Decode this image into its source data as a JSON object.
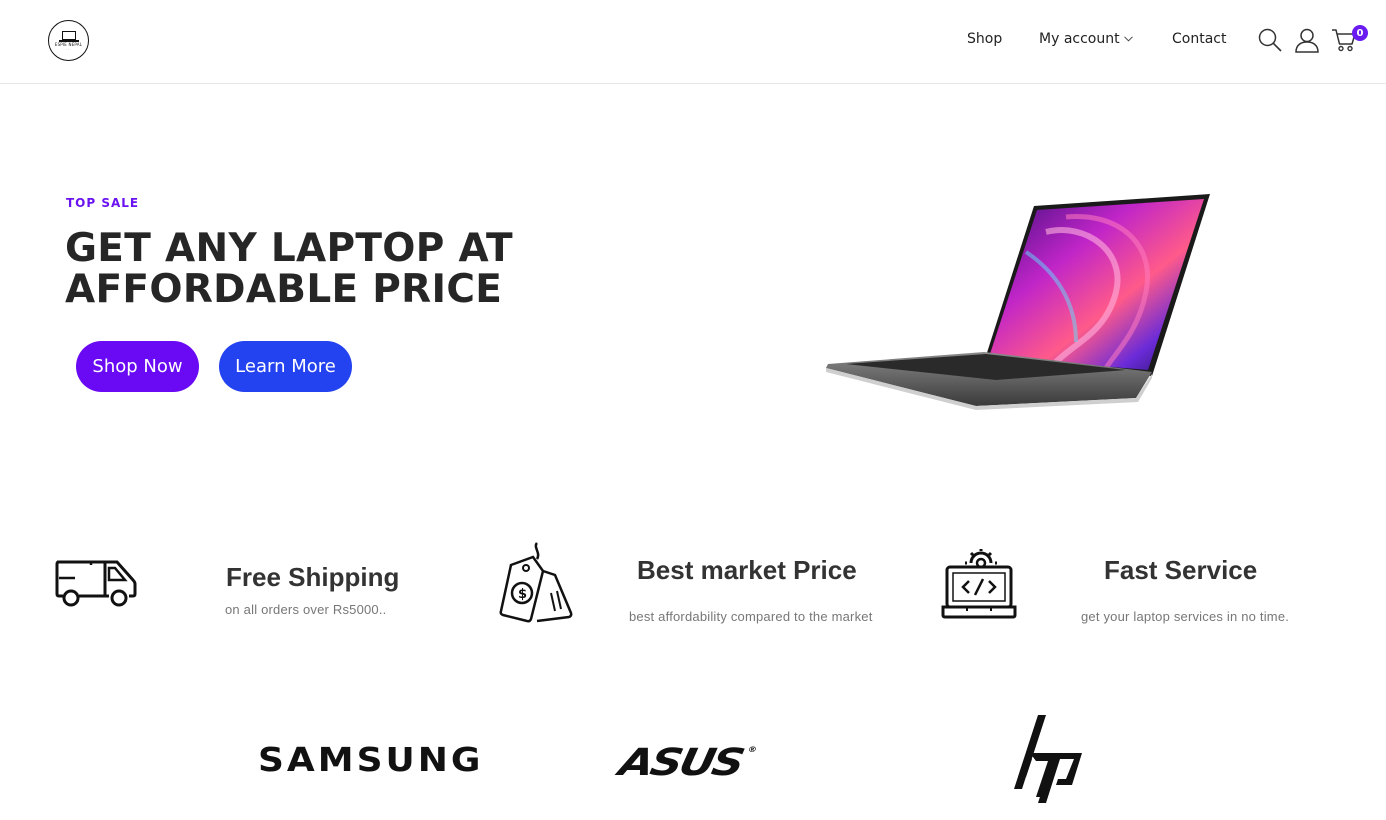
{
  "header": {
    "logo_text": "ESPIE NEPAL",
    "logo_sub": "· · ·",
    "nav": {
      "shop": "Shop",
      "account": "My account",
      "contact": "Contact"
    },
    "icons": [
      "search-icon",
      "user-icon",
      "cart-icon",
      "chevron-down-icon"
    ],
    "cart_count": "0",
    "badge_color": "#6a1bf0"
  },
  "hero": {
    "eyebrow": "TOP SALE",
    "title_line1": "GET ANY LAPTOP AT",
    "title_line2": "AFFORDABLE PRICE",
    "shop_button": "Shop Now",
    "learn_button": "Learn More",
    "shop_button_color": "#6a0af5",
    "learn_button_color": "#2342f0"
  },
  "features": [
    {
      "icon": "delivery-truck-icon",
      "title": "Free Shipping",
      "subtitle": "on all orders over Rs5000.."
    },
    {
      "icon": "price-tag-icon",
      "title": "Best market Price",
      "subtitle": "best affordability compared to the market"
    },
    {
      "icon": "laptop-service-icon",
      "title": "Fast Service",
      "subtitle": "get your laptop services in no time."
    }
  ],
  "brands": {
    "samsung": "SAMSUNG",
    "asus": "ASUS",
    "asus_mark": "®"
  }
}
